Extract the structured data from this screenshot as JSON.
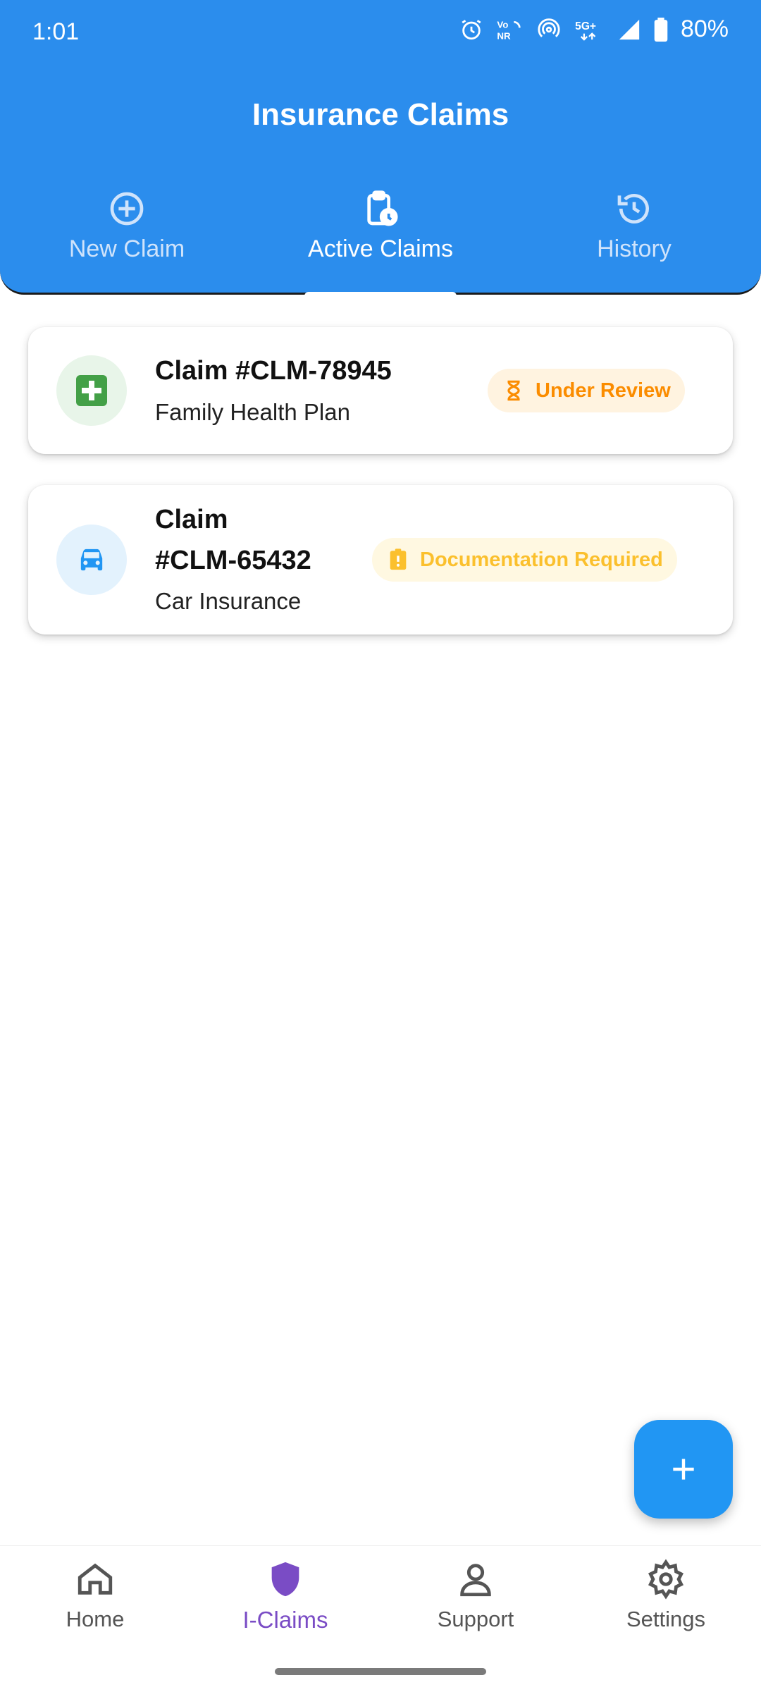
{
  "status_bar": {
    "time": "1:01",
    "battery": "80%",
    "icons": [
      "alarm-icon",
      "vonr-icon",
      "hotspot-icon",
      "5g-icon",
      "signal-icon",
      "battery-icon"
    ]
  },
  "header": {
    "title": "Insurance Claims"
  },
  "tabs": [
    {
      "label": "New Claim",
      "icon": "add-circle-icon",
      "active": false
    },
    {
      "label": "Active Claims",
      "icon": "clipboard-clock-icon",
      "active": true
    },
    {
      "label": "History",
      "icon": "history-icon",
      "active": false
    }
  ],
  "claims": [
    {
      "title": "Claim #CLM-78945",
      "subtitle": "Family Health Plan",
      "status": "Under Review",
      "icon": "medical-cross-icon",
      "status_icon": "hourglass-icon",
      "colors": {
        "avatar_bg": "#e8f5e9",
        "icon": "#43a047",
        "badge_bg": "#fff3e0",
        "badge_text": "#fb8c00"
      }
    },
    {
      "title_line1": "Claim",
      "title_line2": "#CLM-65432",
      "subtitle": "Car Insurance",
      "status": "Documentation Required",
      "icon": "car-icon",
      "status_icon": "alert-clipboard-icon",
      "colors": {
        "avatar_bg": "#e3f2fd",
        "icon": "#2196f3",
        "badge_bg": "#fff8e1",
        "badge_text": "#fbc02d"
      }
    }
  ],
  "fab": {
    "icon": "plus-icon"
  },
  "bottom_nav": [
    {
      "label": "Home",
      "icon": "home-icon",
      "active": false
    },
    {
      "label": "I-Claims",
      "icon": "shield-icon",
      "active": true
    },
    {
      "label": "Support",
      "icon": "person-icon",
      "active": false
    },
    {
      "label": "Settings",
      "icon": "gear-icon",
      "active": false
    }
  ],
  "colors": {
    "primary": "#2b8ded",
    "fab": "#2196f3",
    "nav_active": "#7a4cc5"
  }
}
